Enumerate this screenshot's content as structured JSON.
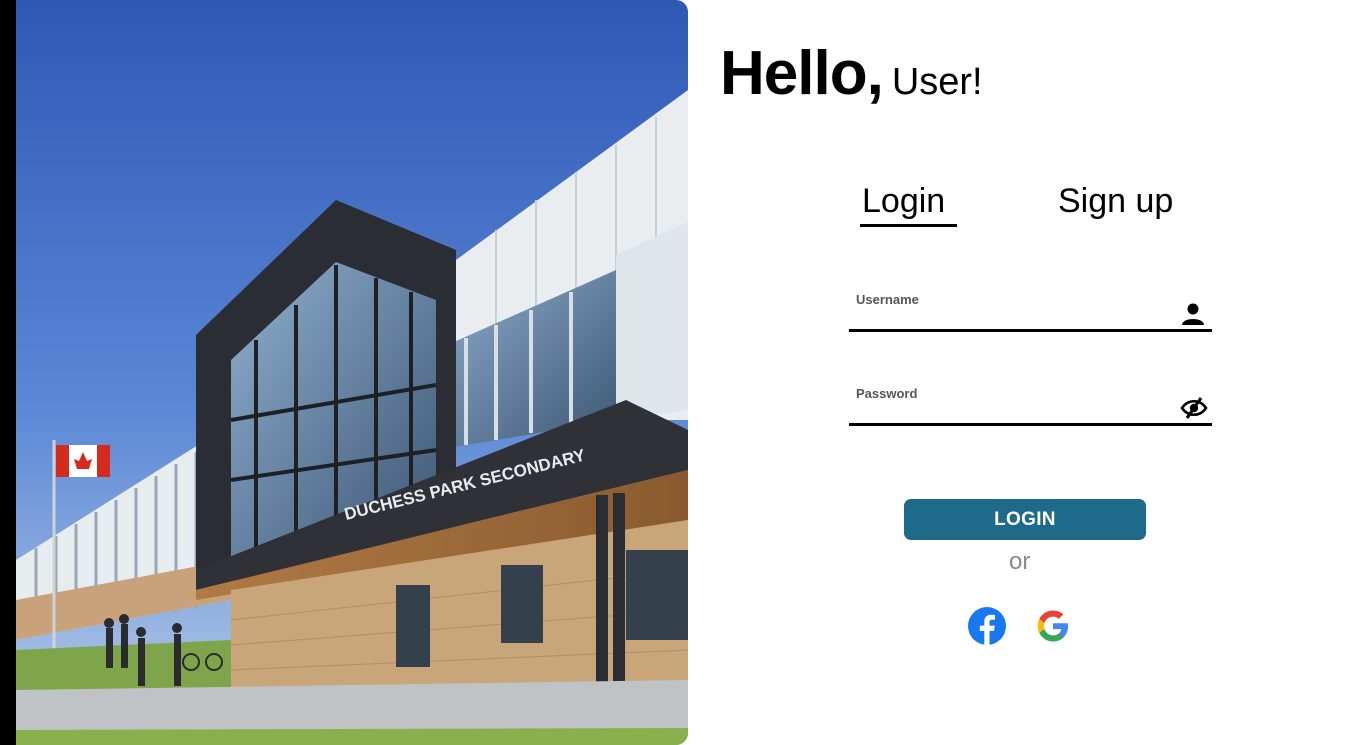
{
  "greeting": {
    "hello": "Hello",
    "comma": ",",
    "user": "User!"
  },
  "tabs": {
    "login": "Login",
    "signup": "Sign up",
    "active": "login"
  },
  "form": {
    "username_label": "Username",
    "username_value": "",
    "password_label": "Password",
    "password_value": "",
    "username_icon": "user-icon",
    "password_icon": "eye-slash-icon"
  },
  "actions": {
    "login_button": "LOGIN",
    "or_text": "or"
  },
  "social": {
    "facebook": "facebook-icon",
    "google": "google-icon"
  },
  "hero": {
    "sign_text": "DUCHESS PARK SECONDARY",
    "flag": "canadian-flag"
  },
  "colors": {
    "primary_button": "#1e6a8a",
    "facebook_blue": "#1877f2",
    "sky": "#3f6ec8"
  }
}
